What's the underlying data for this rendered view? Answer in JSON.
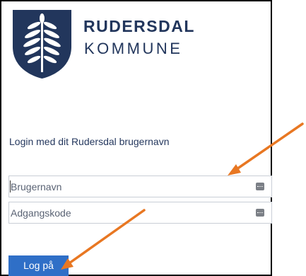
{
  "brand": {
    "name": "RUDERSDAL",
    "subtitle": "KOMMUNE"
  },
  "login": {
    "heading": "Login med dit Rudersdal brugernavn",
    "username": {
      "value": "",
      "placeholder": "Brugernavn"
    },
    "password": {
      "value": "",
      "placeholder": "Adgangskode"
    },
    "submit_label": "Log på"
  },
  "colors": {
    "brand_navy": "#22365c",
    "button_blue": "#2f6fc7",
    "annotation_arrow": "#e87722"
  },
  "icons": {
    "field_icon": "key-icon",
    "logo": "leaf-branch-shield"
  }
}
